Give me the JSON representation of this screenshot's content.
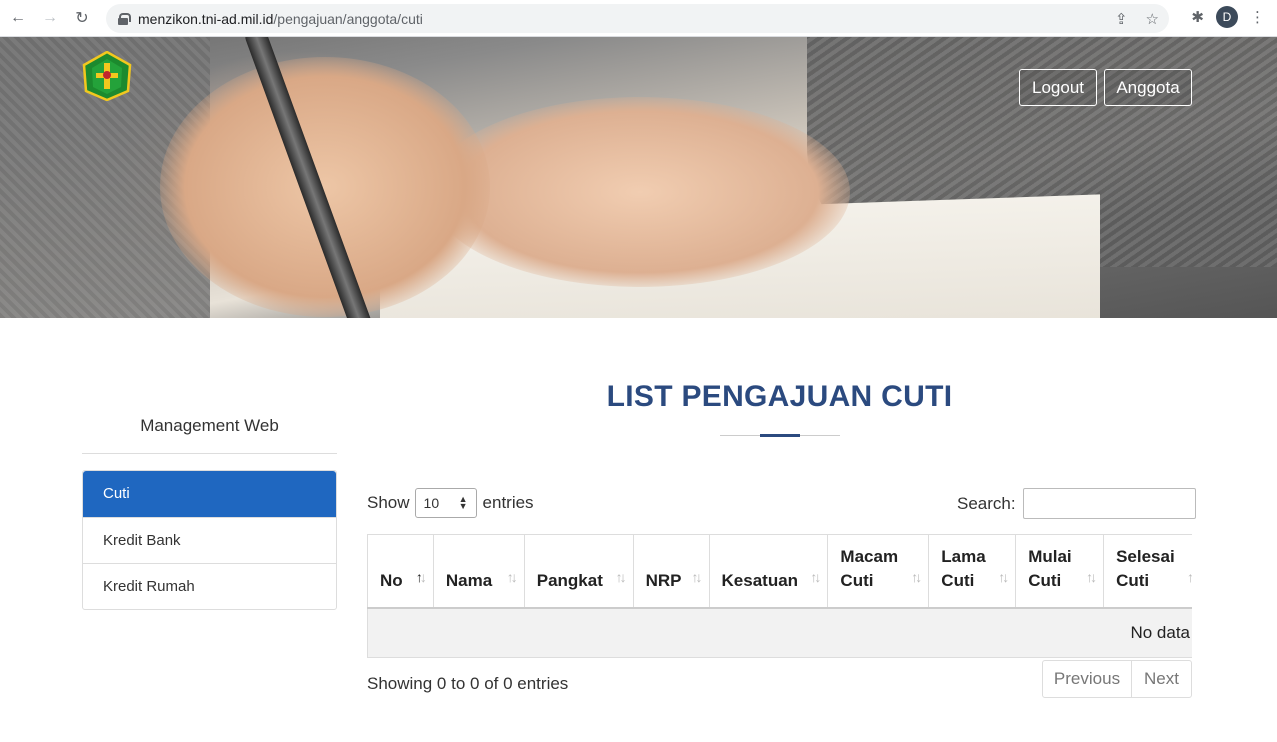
{
  "browser": {
    "url_host": "menzikon.tni-ad.mil.id",
    "url_path": "/pengajuan/anggota/cuti",
    "profile_initial": "D"
  },
  "header": {
    "logout_label": "Logout",
    "anggota_label": "Anggota"
  },
  "sidebar": {
    "title": "Management Web",
    "items": [
      {
        "label": "Cuti",
        "active": true
      },
      {
        "label": "Kredit Bank",
        "active": false
      },
      {
        "label": "Kredit Rumah",
        "active": false
      }
    ]
  },
  "main": {
    "title": "LIST PENGAJUAN CUTI",
    "show_label": "Show",
    "entries_label": "entries",
    "length_value": "10",
    "search_label": "Search:",
    "search_value": "",
    "columns": [
      {
        "l1": "",
        "l2": "No"
      },
      {
        "l1": "",
        "l2": "Nama"
      },
      {
        "l1": "",
        "l2": "Pangkat"
      },
      {
        "l1": "",
        "l2": "NRP"
      },
      {
        "l1": "",
        "l2": "Kesatuan"
      },
      {
        "l1": "Macam",
        "l2": "Cuti"
      },
      {
        "l1": "Lama",
        "l2": "Cuti"
      },
      {
        "l1": "Mulai",
        "l2": "Cuti"
      },
      {
        "l1": "Selesai",
        "l2": "Cuti"
      }
    ],
    "empty_text": "No data",
    "info_text": "Showing 0 to 0 of 0 entries",
    "prev_label": "Previous",
    "next_label": "Next"
  },
  "colors": {
    "accent": "#1f67c0",
    "title": "#2b4a7f"
  }
}
